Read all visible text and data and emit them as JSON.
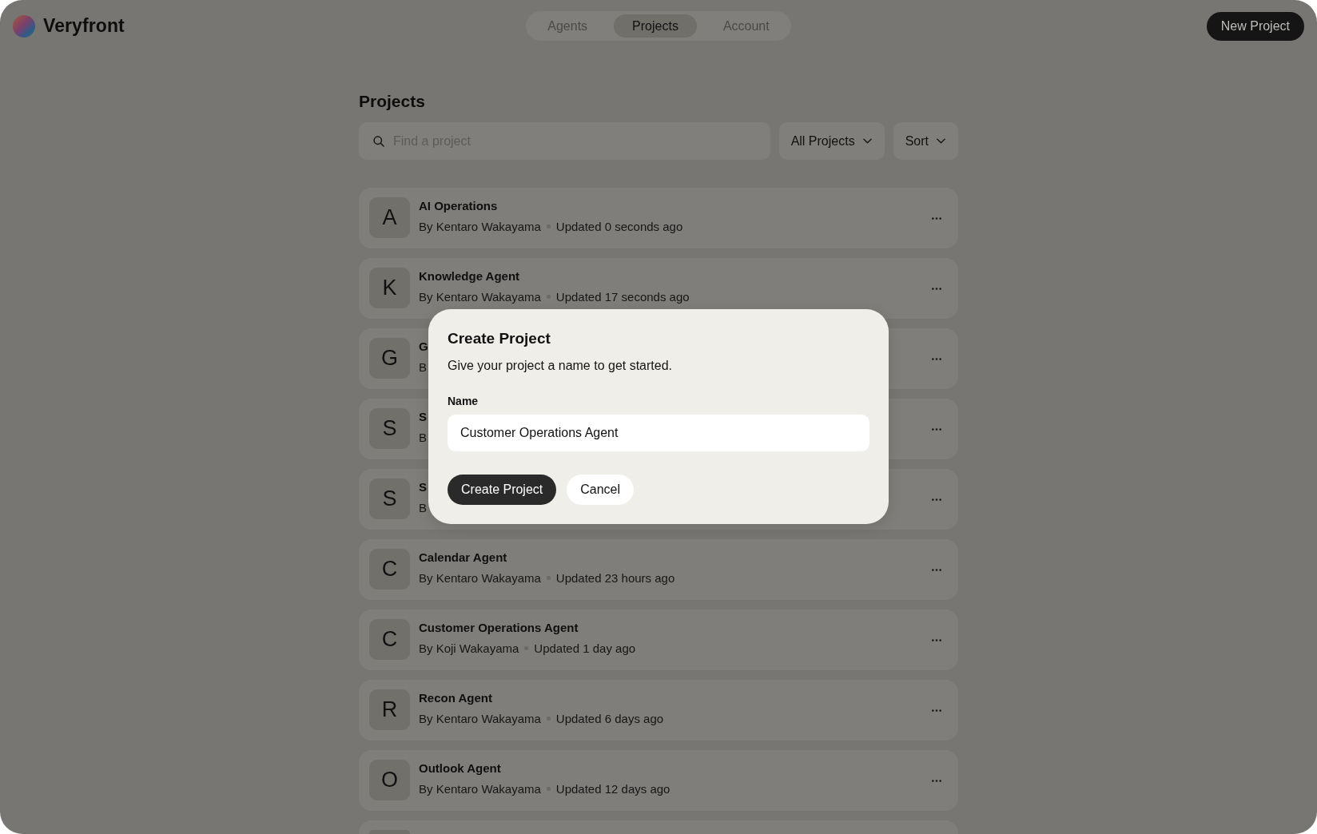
{
  "app": {
    "name": "Veryfront"
  },
  "nav": {
    "tabs": [
      {
        "label": "Agents",
        "selected": false
      },
      {
        "label": "Projects",
        "selected": true
      },
      {
        "label": "Account",
        "selected": false
      }
    ]
  },
  "new_project_button": "New Project",
  "page": {
    "title": "Projects",
    "search": {
      "placeholder": "Find a project"
    },
    "filters": [
      {
        "label": "All Projects"
      },
      {
        "label": "Sort"
      }
    ]
  },
  "projects": [
    {
      "initial": "A",
      "name": "AI Operations",
      "author": "By Kentaro Wakayama",
      "updated": "Updated 0 seconds ago"
    },
    {
      "initial": "K",
      "name": "Knowledge Agent",
      "author": "By Kentaro Wakayama",
      "updated": "Updated 17 seconds ago"
    },
    {
      "initial": "G",
      "name": "G",
      "author": "B"
    },
    {
      "initial": "S",
      "name": "S",
      "author": "B"
    },
    {
      "initial": "S",
      "name": "S",
      "author": "B"
    },
    {
      "initial": "C",
      "name": "Calendar Agent",
      "author": "By Kentaro Wakayama",
      "updated": "Updated 23 hours ago"
    },
    {
      "initial": "C",
      "name": "Customer Operations Agent",
      "author": "By Koji Wakayama",
      "updated": "Updated 1 day ago"
    },
    {
      "initial": "R",
      "name": "Recon Agent",
      "author": "By Kentaro Wakayama",
      "updated": "Updated 6 days ago"
    },
    {
      "initial": "O",
      "name": "Outlook Agent",
      "author": "By Kentaro Wakayama",
      "updated": "Updated 12 days ago"
    }
  ],
  "dialog": {
    "title": "Create Project",
    "description": "Give your project a name to get started.",
    "field": {
      "label": "Name",
      "value": "Customer Operations Agent"
    },
    "buttons": [
      {
        "label": "Create Project",
        "kind": "primary"
      },
      {
        "label": "Cancel",
        "kind": "secondary"
      }
    ]
  }
}
